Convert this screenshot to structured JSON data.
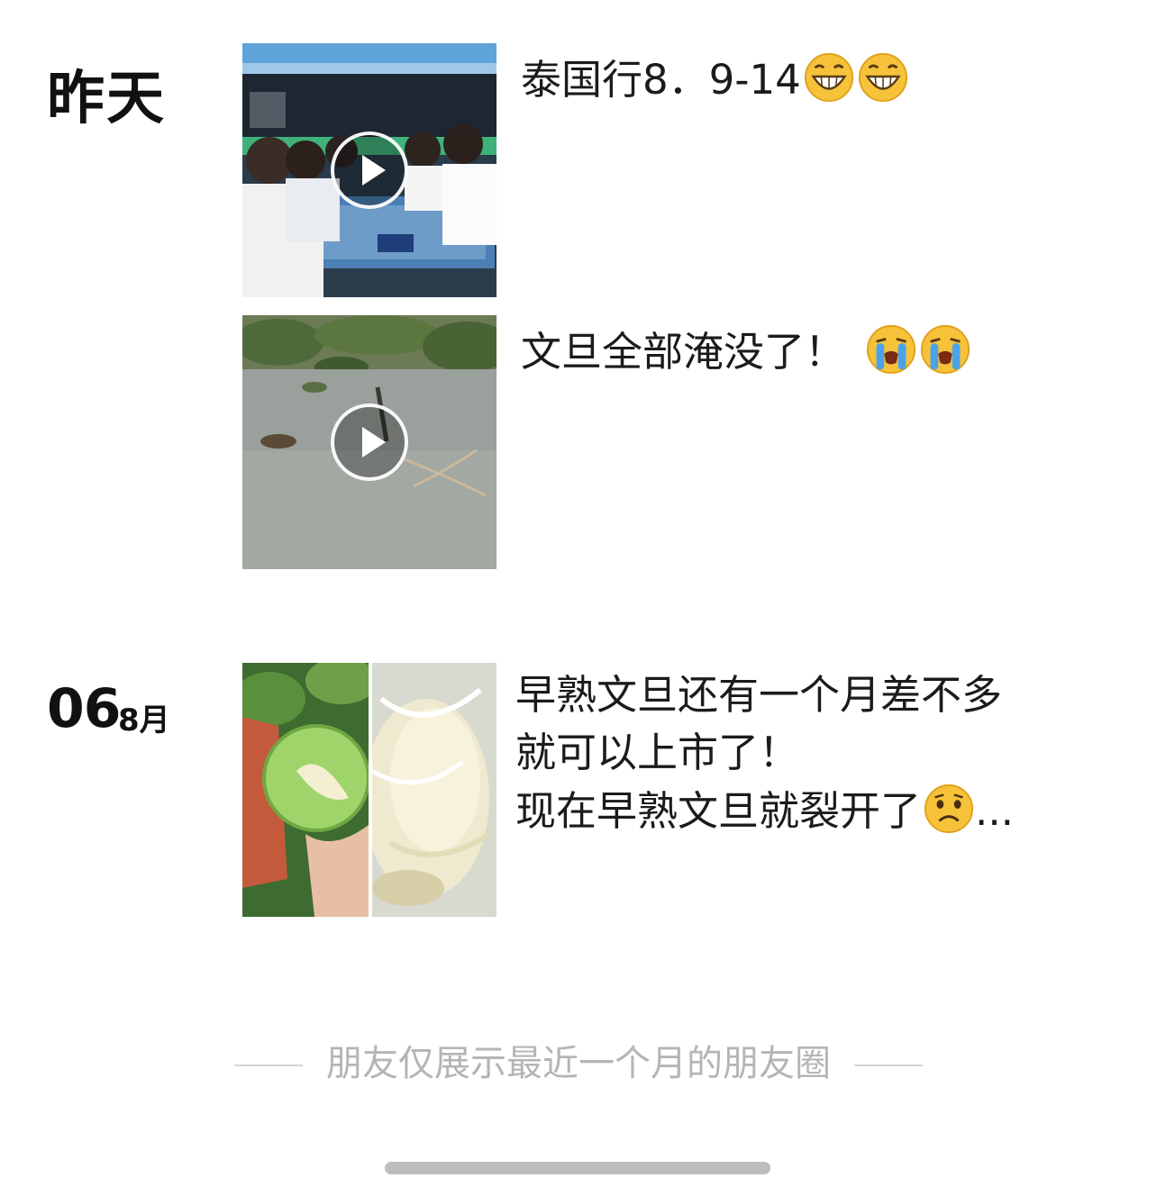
{
  "timeline": {
    "group1": {
      "date_label": "昨天",
      "posts": [
        {
          "text": "泰国行8．9-14",
          "emoji": [
            "grin-emoji",
            "grin-emoji"
          ],
          "media_type": "video"
        },
        {
          "text": "文旦全部淹没了！",
          "emoji": [
            "crying-emoji",
            "crying-emoji"
          ],
          "media_type": "video"
        }
      ]
    },
    "group2": {
      "day": "06",
      "month": "8月",
      "posts": [
        {
          "lines": [
            "早熟文旦还有一个月差不多",
            "就可以上市了！",
            "现在早熟文旦就裂开了"
          ],
          "suffix": "...",
          "emoji": [
            "frown-emoji"
          ],
          "media_type": "photos",
          "photo_count": 2
        }
      ]
    }
  },
  "footer": {
    "note": "朋友仅展示最近一个月的朋友圈"
  },
  "colors": {
    "text": "#1b1b1b",
    "footer_text": "#b5b5b5",
    "emoji_yellow": "#f6c23a",
    "tear_blue": "#4aa3e8"
  }
}
